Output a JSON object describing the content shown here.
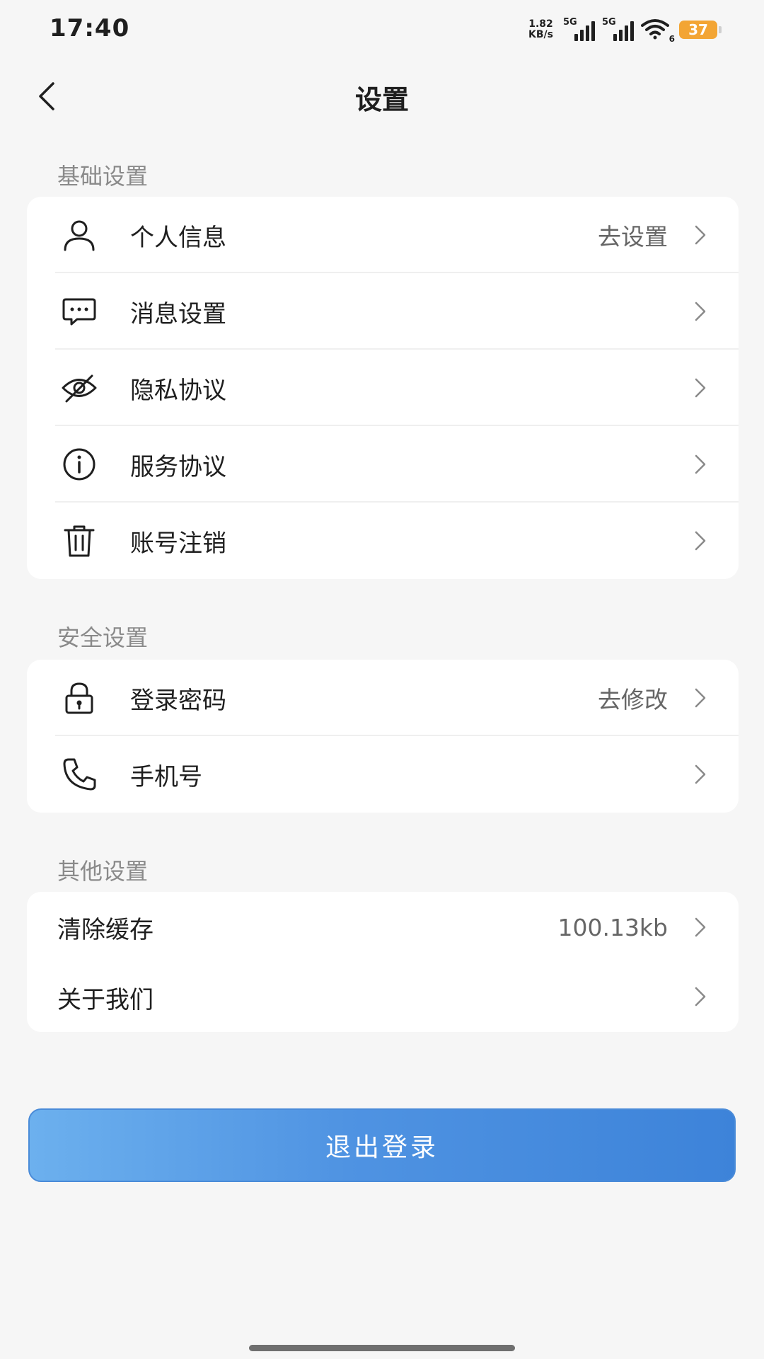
{
  "status_bar": {
    "time": "17:40",
    "net_speed_value": "1.82",
    "net_speed_unit": "KB/s",
    "sim1_label": "5G",
    "sim2_label": "5G",
    "wifi_badge": "6",
    "battery": "37",
    "battery_color": "#f3a534"
  },
  "header": {
    "title": "设置",
    "back_icon": "chevron-left-icon"
  },
  "sections": [
    {
      "title": "基础设置",
      "items": [
        {
          "icon": "user-icon",
          "label": "个人信息",
          "value": "去设置"
        },
        {
          "icon": "message-icon",
          "label": "消息设置",
          "value": ""
        },
        {
          "icon": "eye-off-icon",
          "label": "隐私协议",
          "value": ""
        },
        {
          "icon": "info-icon",
          "label": "服务协议",
          "value": ""
        },
        {
          "icon": "trash-icon",
          "label": "账号注销",
          "value": ""
        }
      ]
    },
    {
      "title": "安全设置",
      "items": [
        {
          "icon": "lock-icon",
          "label": "登录密码",
          "value": "去修改"
        },
        {
          "icon": "phone-icon",
          "label": "手机号",
          "value": ""
        }
      ]
    },
    {
      "title": "其他设置",
      "items": [
        {
          "label": "清除缓存",
          "value": "100.13kb"
        },
        {
          "label": "关于我们",
          "value": ""
        }
      ]
    }
  ],
  "logout": {
    "label": "退出登录",
    "accent": "#4a8bd8"
  }
}
